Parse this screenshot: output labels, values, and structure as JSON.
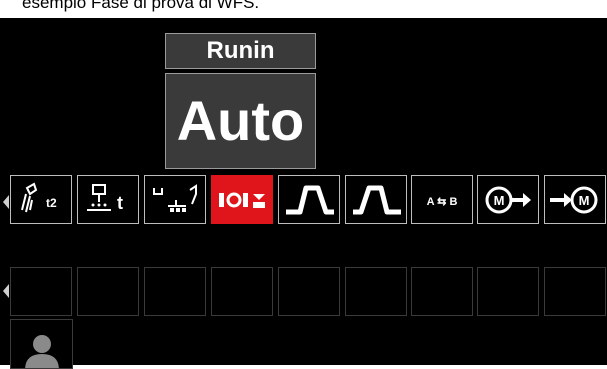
{
  "caption": "esempio Fase di prova di WFS.",
  "parameter": {
    "label": "Runin",
    "value": "Auto"
  },
  "row1": [
    {
      "icon": "burnback-t2-icon",
      "text": "t2",
      "selected": false
    },
    {
      "icon": "preflow-time-icon",
      "text": "t",
      "selected": false
    },
    {
      "icon": "postflow-time-icon",
      "selected": false
    },
    {
      "icon": "run-in-wfs-icon",
      "selected": true
    },
    {
      "icon": "arc-start-profile-icon",
      "selected": false
    },
    {
      "icon": "arc-end-profile-icon",
      "selected": false
    },
    {
      "icon": "procedure-ab-icon",
      "text": "A ⇆ B",
      "selected": false
    },
    {
      "icon": "memory-save-icon",
      "text": "M",
      "selected": false
    },
    {
      "icon": "memory-recall-icon",
      "text": "M",
      "selected": false
    }
  ],
  "row2_empty_count": 9,
  "user": {
    "icon": "user-profile-icon"
  },
  "colors": {
    "screen": "#000000",
    "selected": "#e0151b",
    "box": "#3a3a3a",
    "tile_border": "#bdbdbd"
  }
}
